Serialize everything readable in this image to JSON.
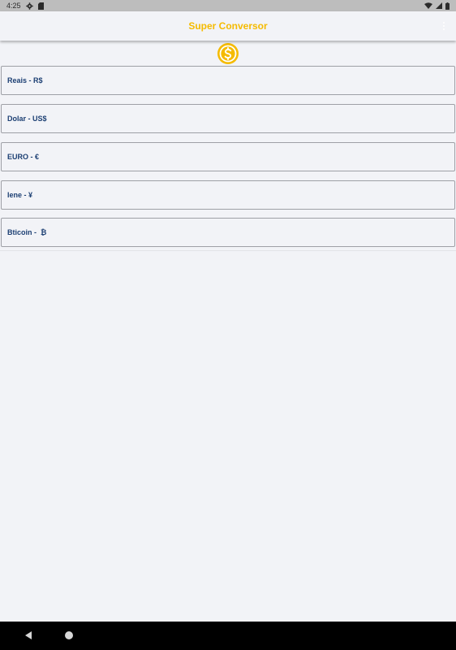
{
  "status_bar": {
    "time": "4:25",
    "left_icons": [
      "gear-icon",
      "sd-card-icon"
    ],
    "right_icons": [
      "wifi-icon",
      "signal-icon",
      "battery-icon"
    ]
  },
  "app_bar": {
    "title": "Super Conversor",
    "title_color": "#f5bb00",
    "menu_icon": "more-vert-icon"
  },
  "logo_icon": "dollar-coin-icon",
  "fields": [
    {
      "label": "Reais - R$"
    },
    {
      "label": "Dolar - US$"
    },
    {
      "label": "EURO - €"
    },
    {
      "label": "Iene - ¥"
    },
    {
      "label": "Bticoin -  ₿"
    }
  ],
  "nav_bar": {
    "icons": [
      "back-icon",
      "home-icon"
    ]
  },
  "colors": {
    "accent": "#f5bb00",
    "label_text": "#1c3f73",
    "background": "#f2f3f7",
    "field_border": "#9ea0a6"
  }
}
